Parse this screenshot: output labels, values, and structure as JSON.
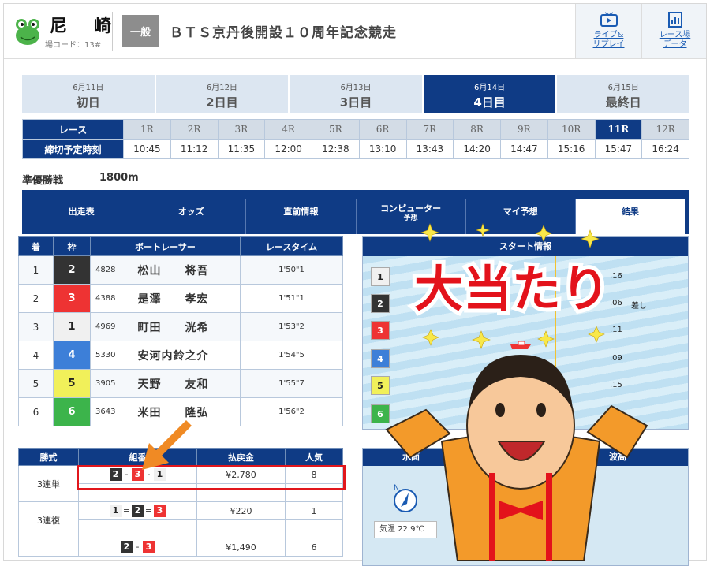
{
  "header": {
    "venue": "尼　崎",
    "venue_code": "場コード：13#",
    "grade": "一般",
    "race_title": "ＢＴＳ京丹後開設１０周年記念競走",
    "live_label_1": "ライブ&",
    "live_label_2": "リプレイ",
    "data_label_1": "レース場",
    "data_label_2": "データ"
  },
  "days": [
    {
      "date": "6月11日",
      "name": "初日"
    },
    {
      "date": "6月12日",
      "name": "2日目"
    },
    {
      "date": "6月13日",
      "name": "3日目"
    },
    {
      "date": "6月14日",
      "name": "4日目"
    },
    {
      "date": "6月15日",
      "name": "最終日"
    }
  ],
  "race_table": {
    "race_label": "レース",
    "deadline_label": "締切予定時刻",
    "races": [
      "1R",
      "2R",
      "3R",
      "4R",
      "5R",
      "6R",
      "7R",
      "8R",
      "9R",
      "10R",
      "11R",
      "12R"
    ],
    "times": [
      "10:45",
      "11:12",
      "11:35",
      "12:00",
      "12:38",
      "13:10",
      "13:43",
      "14:20",
      "14:47",
      "15:16",
      "15:47",
      "16:24"
    ],
    "selected": "11R"
  },
  "race_info": {
    "round": "準優勝戦",
    "distance": "1800m"
  },
  "nav": {
    "tabs": [
      "出走表",
      "オッズ",
      "直前情報",
      "コンピューター",
      "マイ予想",
      "結果"
    ],
    "computer_sub": "予想"
  },
  "results": {
    "headers": [
      "着",
      "枠",
      "ボートレーサー",
      "レースタイム"
    ],
    "rows": [
      {
        "place": "1",
        "lane": "2",
        "reg": "4828",
        "name": "松山　　将吾",
        "time": "1'50\"1"
      },
      {
        "place": "2",
        "lane": "3",
        "reg": "4388",
        "name": "是澤　　孝宏",
        "time": "1'51\"1"
      },
      {
        "place": "3",
        "lane": "1",
        "reg": "4969",
        "name": "町田　　洸希",
        "time": "1'53\"2"
      },
      {
        "place": "4",
        "lane": "4",
        "reg": "5330",
        "name": "安河内鈴之介",
        "time": "1'54\"5"
      },
      {
        "place": "5",
        "lane": "5",
        "reg": "3905",
        "name": "天野　　友和",
        "time": "1'55\"7"
      },
      {
        "place": "6",
        "lane": "6",
        "reg": "3643",
        "name": "米田　　隆弘",
        "time": "1'56\"2"
      }
    ]
  },
  "start_info": {
    "title": "スタート情報",
    "lanes": [
      "1",
      "2",
      "3",
      "4",
      "5",
      "6"
    ],
    "st": [
      ".16",
      ".06",
      ".11",
      ".09",
      ".15",
      "."
    ],
    "note_2": "差し"
  },
  "payout": {
    "headers": [
      "勝式",
      "組番",
      "払戻金",
      "人気"
    ],
    "rows": [
      {
        "type": "3連単",
        "combo": [
          "2",
          "3",
          "1"
        ],
        "sep": "-",
        "amount": "¥2,780",
        "pop": "8"
      },
      {
        "type": "3連複",
        "combo": [
          "1",
          "2",
          "3"
        ],
        "sep": "=",
        "amount": "¥220",
        "pop": "1"
      },
      {
        "type": "",
        "combo": [
          "2",
          "3"
        ],
        "sep": "-",
        "amount": "¥1,490",
        "pop": "6"
      }
    ]
  },
  "weather": {
    "title_left": "水面",
    "title_right": "波高",
    "temp_label": "気温",
    "temp_value": "22.9℃",
    "compass": "N"
  },
  "overlay": {
    "caption": "大当たり"
  },
  "colors": {
    "navy": "#0f3b85",
    "highlight": "#e1161c",
    "arrow": "#f08a24"
  }
}
